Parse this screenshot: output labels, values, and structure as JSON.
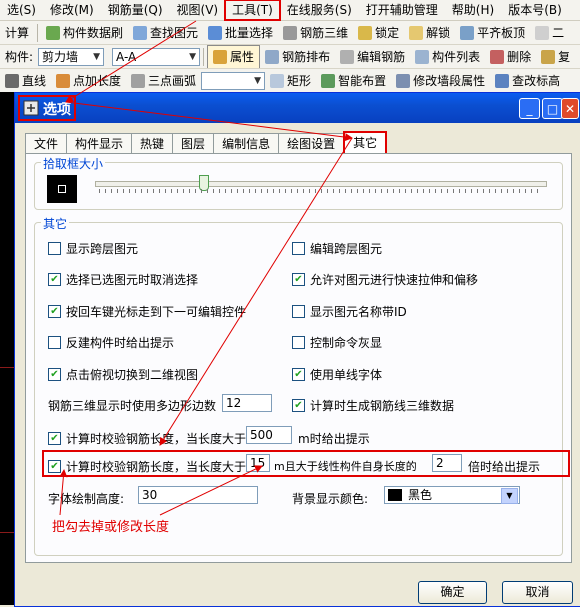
{
  "menubar": {
    "items": [
      "选(S)",
      "修改(M)",
      "钢筋量(Q)",
      "视图(V)",
      "工具(T)",
      "在线服务(S)",
      "打开辅助管理",
      "帮助(H)",
      "版本号(B)"
    ]
  },
  "toolbar1": {
    "items": [
      "计算",
      "构件数据刷",
      "查找图元",
      "批量选择",
      "钢筋三维",
      "锁定",
      "解锁",
      "平齐板顶",
      "二"
    ]
  },
  "toolbar2": {
    "label": "构件:",
    "combo1": "剪力墙",
    "combo2": "A-A",
    "items": [
      "属性",
      "钢筋排布",
      "编辑钢筋",
      "构件列表",
      "删除",
      "复"
    ]
  },
  "toolbar3": {
    "items": [
      "直线",
      "点加长度",
      "三点画弧",
      "矩形",
      "智能布置",
      "修改墙段属性",
      "查改标高"
    ]
  },
  "dialog": {
    "title": "选项",
    "tabs": [
      "文件",
      "构件显示",
      "热键",
      "图层",
      "编制信息",
      "绘图设置",
      "其它"
    ],
    "pick_group_label": "拾取框大小",
    "pick_value": 0.24,
    "other_group_label": "其它",
    "left_options": [
      {
        "label": "显示跨层图元",
        "checked": false
      },
      {
        "label": "选择已选图元时取消选择",
        "checked": true
      },
      {
        "label": "按回车键光标走到下一可编辑控件",
        "checked": true
      },
      {
        "label": "反建构件时给出提示",
        "checked": false
      },
      {
        "label": "点击俯视切换到二维视图",
        "checked": true
      }
    ],
    "right_options": [
      {
        "label": "编辑跨层图元",
        "checked": false
      },
      {
        "label": "允许对图元进行快速拉伸和偏移",
        "checked": true
      },
      {
        "label": "显示图元名称带ID",
        "checked": false
      },
      {
        "label": "控制命令灰显",
        "checked": false
      },
      {
        "label": "使用单线字体",
        "checked": true
      },
      {
        "label": "计算时生成钢筋线三维数据",
        "checked": true
      }
    ],
    "polygon_label": "钢筋三维显示时使用多边形边数",
    "polygon_value": "12",
    "check1": {
      "prefix": "计算时校验钢筋长度，当长度大于",
      "value": "500",
      "suffix": "m时给出提示",
      "checked": true
    },
    "check2": {
      "prefix": "计算时校验钢筋长度，当长度大于",
      "value": "15",
      "middle": "m且大于线性构件自身长度的",
      "value2": "2",
      "suffix": "倍时给出提示",
      "checked": true
    },
    "font_height_label": "字体绘制高度:",
    "font_height_value": "30",
    "bg_color_label": "背景显示颜色:",
    "bg_color_value": "黑色",
    "annotation": "把勾去掉或修改长度",
    "ok": "确定",
    "cancel": "取消"
  },
  "colors": {
    "highlight": "#e00000",
    "title_blue": "#0b4fd1",
    "check_green": "#21a121"
  }
}
